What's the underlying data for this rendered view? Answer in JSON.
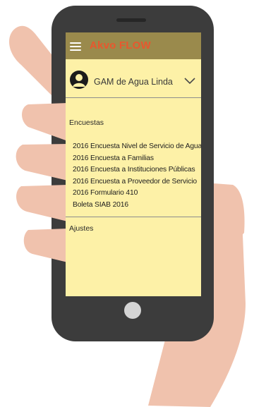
{
  "app": {
    "title": "Akvo FLOW"
  },
  "account": {
    "name": "GAM de Agua Linda"
  },
  "drawer": {
    "surveys_heading": "Encuestas",
    "surveys": [
      {
        "label": "2016 Encuesta Nivel de Servicio de Agua"
      },
      {
        "label": "2016 Encuesta a Familias"
      },
      {
        "label": "2016 Encuesta a Instituciones Públicas"
      },
      {
        "label": "2016 Encuesta a Proveedor de Servicio"
      },
      {
        "label": "2016 Formulario 410"
      },
      {
        "label": "Boleta SIAB 2016"
      }
    ],
    "settings_label": "Ajustes"
  },
  "icons": {
    "menu": "hamburger-menu-icon",
    "avatar": "user-account-icon",
    "dropdown": "chevron-down-icon"
  },
  "colors": {
    "screen_background": "#fdf1a7",
    "app_bar": "#9a8a4c",
    "title": "#e8572e",
    "phone_body": "#3c3c3c",
    "hand": "#f0c2ad"
  }
}
